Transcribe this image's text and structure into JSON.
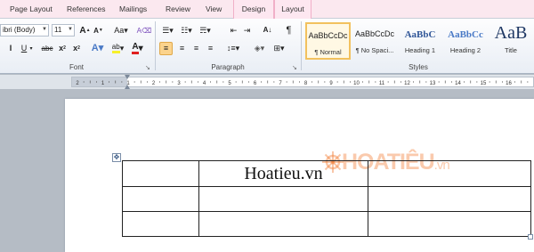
{
  "tabs": [
    "Page Layout",
    "References",
    "Mailings",
    "Review",
    "View",
    "Design",
    "Layout"
  ],
  "font": {
    "name": "ibri (Body)",
    "size": "11",
    "group_label": "Font"
  },
  "paragraph": {
    "group_label": "Paragraph"
  },
  "styles": {
    "group_label": "Styles",
    "items": [
      {
        "preview": "AaBbCcDc",
        "name": "¶ Normal"
      },
      {
        "preview": "AaBbCcDc",
        "name": "¶ No Spaci..."
      },
      {
        "preview": "AaBbC",
        "name": "Heading 1"
      },
      {
        "preview": "AaBbCc",
        "name": "Heading 2"
      },
      {
        "preview": "AaB",
        "name": "Title"
      }
    ]
  },
  "ruler": {
    "numbers": [
      "2",
      "1",
      "1",
      "2",
      "3",
      "4",
      "5",
      "6",
      "7",
      "8",
      "9",
      "10",
      "11",
      "12",
      "13",
      "14",
      "15",
      "16"
    ]
  },
  "document": {
    "table": [
      [
        "",
        "Hoatieu.vn",
        ""
      ],
      [
        "",
        "",
        ""
      ],
      [
        "",
        "",
        ""
      ]
    ],
    "watermark": {
      "main": "HOATIÊU",
      "suffix": ".vn"
    }
  },
  "colors": {
    "tab_bar": "#fbe8ef",
    "accent": "#f2c15e",
    "watermark": "#f2803b",
    "heading_blue": "#2f5597"
  }
}
